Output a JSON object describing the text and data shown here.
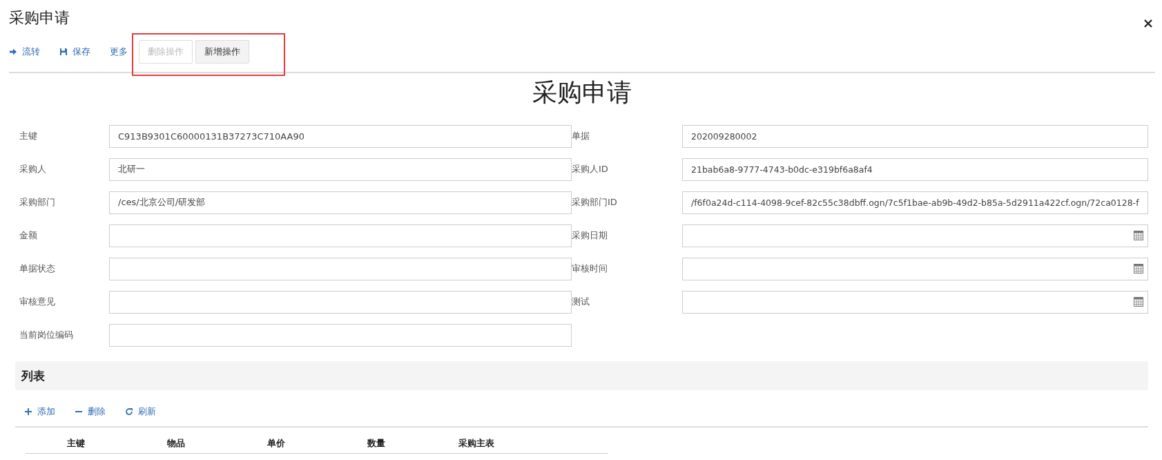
{
  "window": {
    "title": "采购申请"
  },
  "toolbar": [
    {
      "label": "流转",
      "kind": "arrow"
    },
    {
      "label": "保存",
      "kind": "save"
    },
    {
      "label": "更多",
      "kind": "plain"
    }
  ],
  "highlighted_buttons": [
    {
      "label": "删除操作",
      "disabled": true
    },
    {
      "label": "新增操作",
      "disabled": false
    }
  ],
  "form": {
    "title": "采购申请",
    "left_fields": [
      {
        "label": "主键",
        "value": "C913B9301C60000131B37273C710AA90"
      },
      {
        "label": "采购人",
        "value": "北研一"
      },
      {
        "label": "采购部门",
        "value": "/ces/北京公司/研发部"
      },
      {
        "label": "金额"
      },
      {
        "label": "单据状态"
      },
      {
        "label": "审核意见"
      },
      {
        "label": "当前岗位编码"
      }
    ],
    "right_fields": [
      {
        "label": "单据",
        "value": "202009280002"
      },
      {
        "label": "采购人ID",
        "value": "21bab6a8-9777-4743-b0dc-e319bf6a8af4"
      },
      {
        "label": "采购部门ID",
        "value": "/f6f0a24d-c114-4098-9cef-82c55c38dbff.ogn/7c5f1bae-ab9b-49d2-b85a-5d2911a422cf.ogn/72ca0128-f"
      },
      {
        "label": "采购日期",
        "kind": "date"
      },
      {
        "label": "审核时间",
        "kind": "date"
      },
      {
        "label": "测试",
        "kind": "date"
      }
    ]
  },
  "list": {
    "title": "列表",
    "toolbar": [
      {
        "label": "添加",
        "kind": "add"
      },
      {
        "label": "删除",
        "kind": "remove"
      },
      {
        "label": "刷新",
        "kind": "refresh"
      }
    ],
    "columns": [
      "主键",
      "物品",
      "单价",
      "数量",
      "采购主表"
    ]
  }
}
